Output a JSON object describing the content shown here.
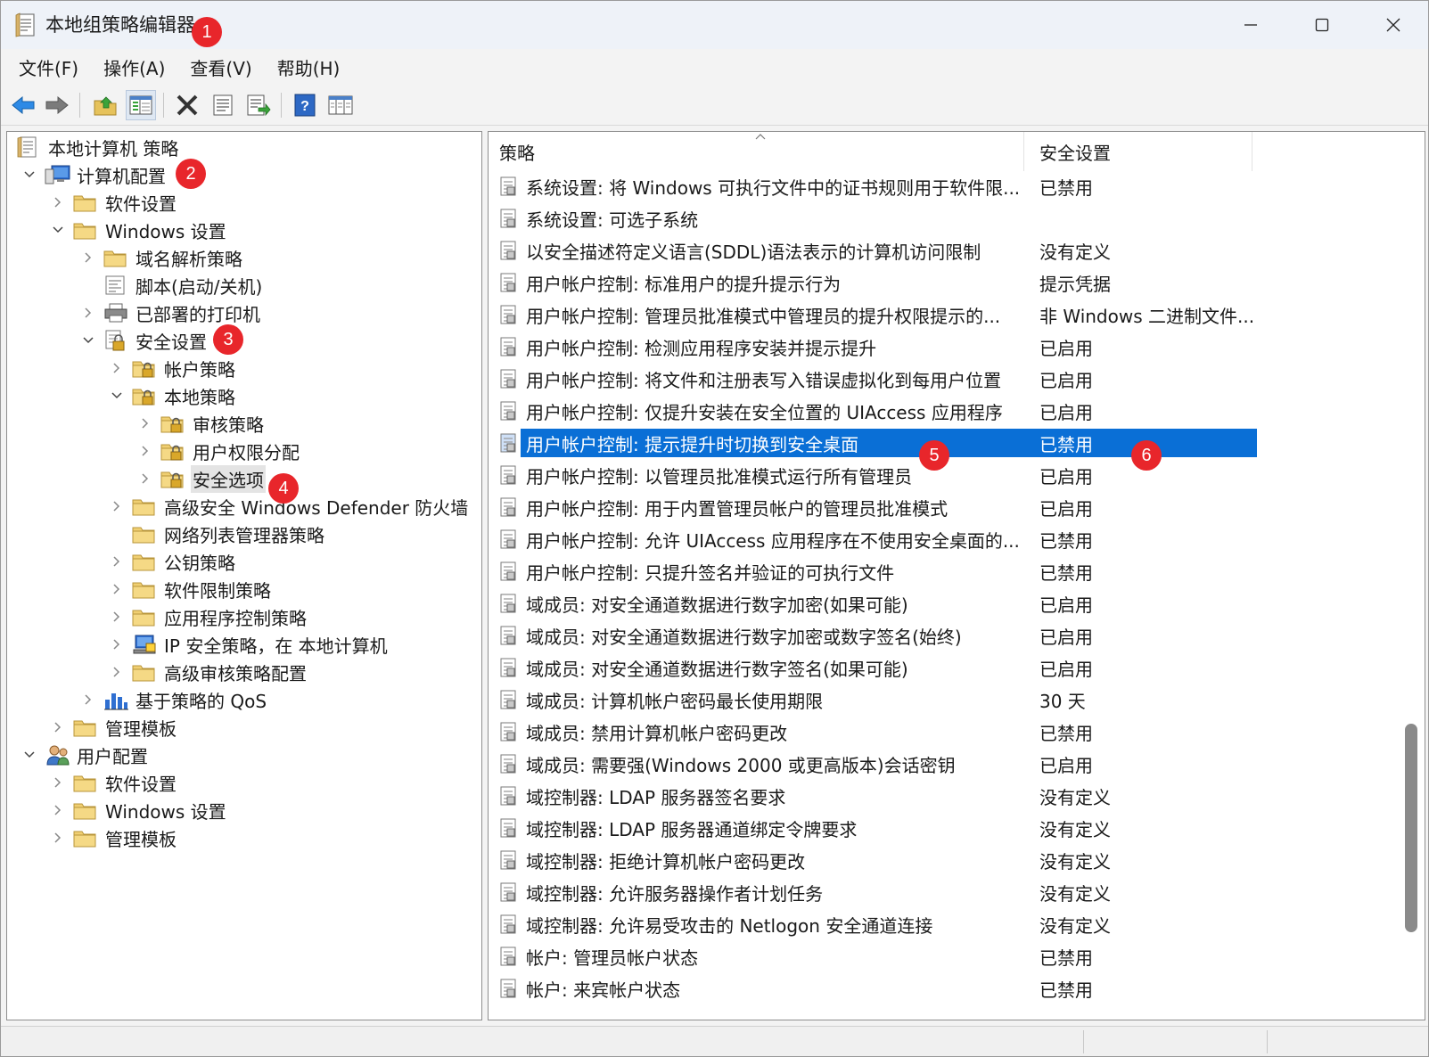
{
  "window": {
    "title": "本地组策略编辑器",
    "controls": {
      "minimize": "minimize-icon",
      "maximize": "maximize-icon",
      "close": "close-icon"
    }
  },
  "menu": [
    "文件(F)",
    "操作(A)",
    "查看(V)",
    "帮助(H)"
  ],
  "toolbar": {
    "buttons": [
      "back-arrow-icon",
      "forward-arrow-icon",
      "up-folder-icon",
      "show-hide-tree-icon",
      "delete-icon",
      "properties-icon",
      "export-list-icon",
      "help-icon",
      "filter-view-icon"
    ]
  },
  "tree": [
    {
      "label": "本地计算机 策略",
      "level": 0,
      "icon": "policy-doc-icon",
      "chevron": "none"
    },
    {
      "label": "计算机配置",
      "level": 1,
      "icon": "computer-icon",
      "chevron": "down"
    },
    {
      "label": "软件设置",
      "level": 2,
      "icon": "folder-icon",
      "chevron": "right"
    },
    {
      "label": "Windows 设置",
      "level": 2,
      "icon": "folder-icon",
      "chevron": "down"
    },
    {
      "label": "域名解析策略",
      "level": 3,
      "icon": "folder-icon",
      "chevron": "right"
    },
    {
      "label": "脚本(启动/关机)",
      "level": 3,
      "icon": "script-icon",
      "chevron": "none"
    },
    {
      "label": "已部署的打印机",
      "level": 3,
      "icon": "printer-icon",
      "chevron": "right"
    },
    {
      "label": "安全设置",
      "level": 3,
      "icon": "security-icon",
      "chevron": "down"
    },
    {
      "label": "帐户策略",
      "level": 4,
      "icon": "lock-folder-icon",
      "chevron": "right"
    },
    {
      "label": "本地策略",
      "level": 4,
      "icon": "lock-folder-icon",
      "chevron": "down"
    },
    {
      "label": "审核策略",
      "level": 5,
      "icon": "lock-folder-icon",
      "chevron": "right"
    },
    {
      "label": "用户权限分配",
      "level": 5,
      "icon": "lock-folder-icon",
      "chevron": "right"
    },
    {
      "label": "安全选项",
      "level": 5,
      "icon": "lock-folder-icon",
      "chevron": "right",
      "selected": true
    },
    {
      "label": "高级安全 Windows Defender 防火墙",
      "level": 4,
      "icon": "folder-icon",
      "chevron": "right"
    },
    {
      "label": "网络列表管理器策略",
      "level": 4,
      "icon": "folder-icon",
      "chevron": "none"
    },
    {
      "label": "公钥策略",
      "level": 4,
      "icon": "folder-icon",
      "chevron": "right"
    },
    {
      "label": "软件限制策略",
      "level": 4,
      "icon": "folder-icon",
      "chevron": "right"
    },
    {
      "label": "应用程序控制策略",
      "level": 4,
      "icon": "folder-icon",
      "chevron": "right"
    },
    {
      "label": "IP 安全策略，在 本地计算机",
      "level": 4,
      "icon": "ip-security-icon",
      "chevron": "right"
    },
    {
      "label": "高级审核策略配置",
      "level": 4,
      "icon": "folder-icon",
      "chevron": "right"
    },
    {
      "label": "基于策略的 QoS",
      "level": 3,
      "icon": "qos-chart-icon",
      "chevron": "right"
    },
    {
      "label": "管理模板",
      "level": 2,
      "icon": "folder-icon",
      "chevron": "right"
    },
    {
      "label": "用户配置",
      "level": 1,
      "icon": "user-icon",
      "chevron": "down"
    },
    {
      "label": "软件设置",
      "level": 2,
      "icon": "folder-icon",
      "chevron": "right"
    },
    {
      "label": "Windows 设置",
      "level": 2,
      "icon": "folder-icon",
      "chevron": "right"
    },
    {
      "label": "管理模板",
      "level": 2,
      "icon": "folder-icon",
      "chevron": "right"
    }
  ],
  "list": {
    "columns": [
      "策略",
      "安全设置"
    ],
    "rows": [
      {
        "policy": "系统设置: 将 Windows 可执行文件中的证书规则用于软件限...",
        "setting": "已禁用"
      },
      {
        "policy": "系统设置: 可选子系统",
        "setting": ""
      },
      {
        "policy": "以安全描述符定义语言(SDDL)语法表示的计算机访问限制",
        "setting": "没有定义"
      },
      {
        "policy": "用户帐户控制: 标准用户的提升提示行为",
        "setting": "提示凭据"
      },
      {
        "policy": "用户帐户控制: 管理员批准模式中管理员的提升权限提示的...",
        "setting": "非 Windows 二进制文件..."
      },
      {
        "policy": "用户帐户控制: 检测应用程序安装并提示提升",
        "setting": "已启用"
      },
      {
        "policy": "用户帐户控制: 将文件和注册表写入错误虚拟化到每用户位置",
        "setting": "已启用"
      },
      {
        "policy": "用户帐户控制: 仅提升安装在安全位置的 UIAccess 应用程序",
        "setting": "已启用"
      },
      {
        "policy": "用户帐户控制: 提示提升时切换到安全桌面",
        "setting": "已禁用",
        "selected": true
      },
      {
        "policy": "用户帐户控制: 以管理员批准模式运行所有管理员",
        "setting": "已启用"
      },
      {
        "policy": "用户帐户控制: 用于内置管理员帐户的管理员批准模式",
        "setting": "已启用"
      },
      {
        "policy": "用户帐户控制: 允许 UIAccess 应用程序在不使用安全桌面的...",
        "setting": "已禁用"
      },
      {
        "policy": "用户帐户控制: 只提升签名并验证的可执行文件",
        "setting": "已禁用"
      },
      {
        "policy": "域成员: 对安全通道数据进行数字加密(如果可能)",
        "setting": "已启用"
      },
      {
        "policy": "域成员: 对安全通道数据进行数字加密或数字签名(始终)",
        "setting": "已启用"
      },
      {
        "policy": "域成员: 对安全通道数据进行数字签名(如果可能)",
        "setting": "已启用"
      },
      {
        "policy": "域成员: 计算机帐户密码最长使用期限",
        "setting": "30 天"
      },
      {
        "policy": "域成员: 禁用计算机帐户密码更改",
        "setting": "已禁用"
      },
      {
        "policy": "域成员: 需要强(Windows 2000 或更高版本)会话密钥",
        "setting": "已启用"
      },
      {
        "policy": "域控制器: LDAP 服务器签名要求",
        "setting": "没有定义"
      },
      {
        "policy": "域控制器: LDAP 服务器通道绑定令牌要求",
        "setting": "没有定义"
      },
      {
        "policy": "域控制器: 拒绝计算机帐户密码更改",
        "setting": "没有定义"
      },
      {
        "policy": "域控制器: 允许服务器操作者计划任务",
        "setting": "没有定义"
      },
      {
        "policy": "域控制器: 允许易受攻击的 Netlogon 安全通道连接",
        "setting": "没有定义"
      },
      {
        "policy": "帐户: 管理员帐户状态",
        "setting": "已禁用"
      },
      {
        "policy": "帐户: 来宾帐户状态",
        "setting": "已禁用"
      }
    ]
  },
  "badges": [
    "1",
    "2",
    "3",
    "4",
    "5",
    "6"
  ],
  "colors": {
    "selection": "#0a6fd6",
    "badge": "#e8262b",
    "titlebar": "#eef2f8"
  }
}
